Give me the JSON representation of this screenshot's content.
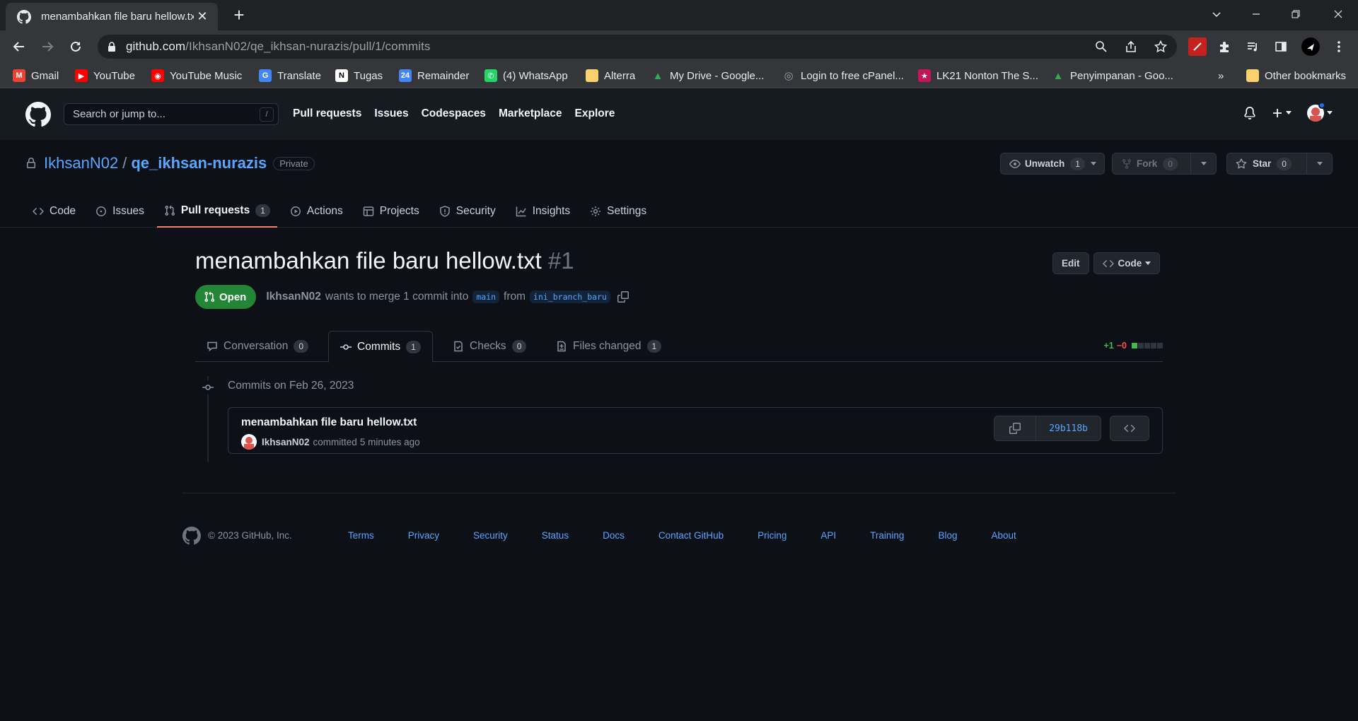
{
  "browser": {
    "tab_title": "menambahkan file baru hellow.txt",
    "url_host": "github.com",
    "url_path": "/IkhsanN02/qe_ikhsan-nurazis/pull/1/commits",
    "bookmarks": [
      {
        "label": "Gmail",
        "icon": "gmail-icon",
        "color": "#ea4335"
      },
      {
        "label": "YouTube",
        "icon": "youtube-icon",
        "color": "#ff0000"
      },
      {
        "label": "YouTube Music",
        "icon": "youtube-music-icon",
        "color": "#ff0000"
      },
      {
        "label": "Translate",
        "icon": "translate-icon",
        "color": "#4285f4"
      },
      {
        "label": "Tugas",
        "icon": "notion-icon",
        "color": "#ffffff"
      },
      {
        "label": "Remainder",
        "icon": "calendar-icon",
        "color": "#4285f4"
      },
      {
        "label": "(4) WhatsApp",
        "icon": "whatsapp-icon",
        "color": "#25d366"
      },
      {
        "label": "Alterra",
        "icon": "folder-icon",
        "color": "#f9d26e"
      },
      {
        "label": "My Drive - Google...",
        "icon": "drive-icon",
        "color": "#34a853"
      },
      {
        "label": "Login to free cPanel...",
        "icon": "globe-icon",
        "color": "#9aa0a6"
      },
      {
        "label": "LK21 Nonton The S...",
        "icon": "lk21-icon",
        "color": "#c2185b"
      },
      {
        "label": "Penyimpanan - Goo...",
        "icon": "drive-icon",
        "color": "#34a853"
      }
    ],
    "other_bookmarks": "Other bookmarks",
    "more_bookmarks": "»"
  },
  "gh_header": {
    "search_placeholder": "Search or jump to...",
    "search_key": "/",
    "nav": [
      "Pull requests",
      "Issues",
      "Codespaces",
      "Marketplace",
      "Explore"
    ]
  },
  "repo": {
    "owner": "IkhsanN02",
    "separator": "/",
    "name": "qe_ikhsan-nurazis",
    "visibility": "Private",
    "unwatch_label": "Unwatch",
    "watch_count": "1",
    "fork_label": "Fork",
    "fork_count": "0",
    "star_label": "Star",
    "star_count": "0",
    "tabs": [
      {
        "label": "Code",
        "icon": "code-icon"
      },
      {
        "label": "Issues",
        "icon": "issue-icon"
      },
      {
        "label": "Pull requests",
        "icon": "pull-request-icon",
        "count": "1",
        "active": true
      },
      {
        "label": "Actions",
        "icon": "play-icon"
      },
      {
        "label": "Projects",
        "icon": "table-icon"
      },
      {
        "label": "Security",
        "icon": "shield-icon"
      },
      {
        "label": "Insights",
        "icon": "graph-icon"
      },
      {
        "label": "Settings",
        "icon": "gear-icon"
      }
    ]
  },
  "pr": {
    "title": "menambahkan file baru hellow.txt",
    "number": "#1",
    "edit_label": "Edit",
    "code_label": "Code",
    "state": "Open",
    "author": "IkhsanN02",
    "merge_text": "wants to merge 1 commit into",
    "base_branch": "main",
    "from_text": "from",
    "head_branch": "ini_branch_baru",
    "tabs": [
      {
        "label": "Conversation",
        "count": "0"
      },
      {
        "label": "Commits",
        "count": "1"
      },
      {
        "label": "Checks",
        "count": "0"
      },
      {
        "label": "Files changed",
        "count": "1"
      }
    ],
    "additions": "+1",
    "deletions": "−0",
    "diff_blocks": [
      "#3fb950",
      "#30363d",
      "#30363d",
      "#30363d",
      "#30363d"
    ]
  },
  "commits": {
    "date_heading": "Commits on Feb 26, 2023",
    "items": [
      {
        "message": "menambahkan file baru hellow.txt",
        "author": "IkhsanN02",
        "action": "committed",
        "time": "5 minutes ago",
        "sha": "29b118b"
      }
    ]
  },
  "footer": {
    "copyright": "© 2023 GitHub, Inc.",
    "links": [
      "Terms",
      "Privacy",
      "Security",
      "Status",
      "Docs",
      "Contact GitHub",
      "Pricing",
      "API",
      "Training",
      "Blog",
      "About"
    ]
  }
}
